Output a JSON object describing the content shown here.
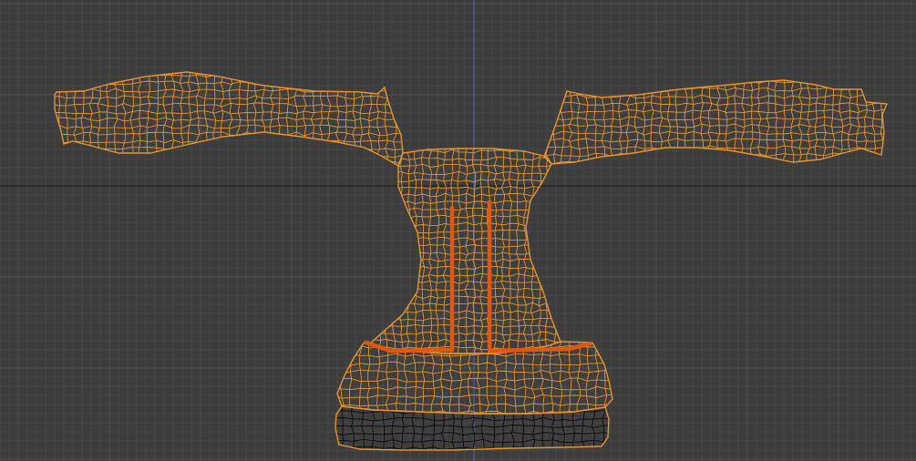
{
  "viewport": {
    "background_color": "#3d3d3d",
    "grid_minor_color": "#474747",
    "grid_major_color": "#505050",
    "x_axis_color": "#1f1f1f",
    "z_axis_color": "#4a5fa8",
    "wire_color": "#e8942c",
    "selected_edge_color": "#e2570f",
    "unselected_wire_color": "#0a0a0a"
  }
}
